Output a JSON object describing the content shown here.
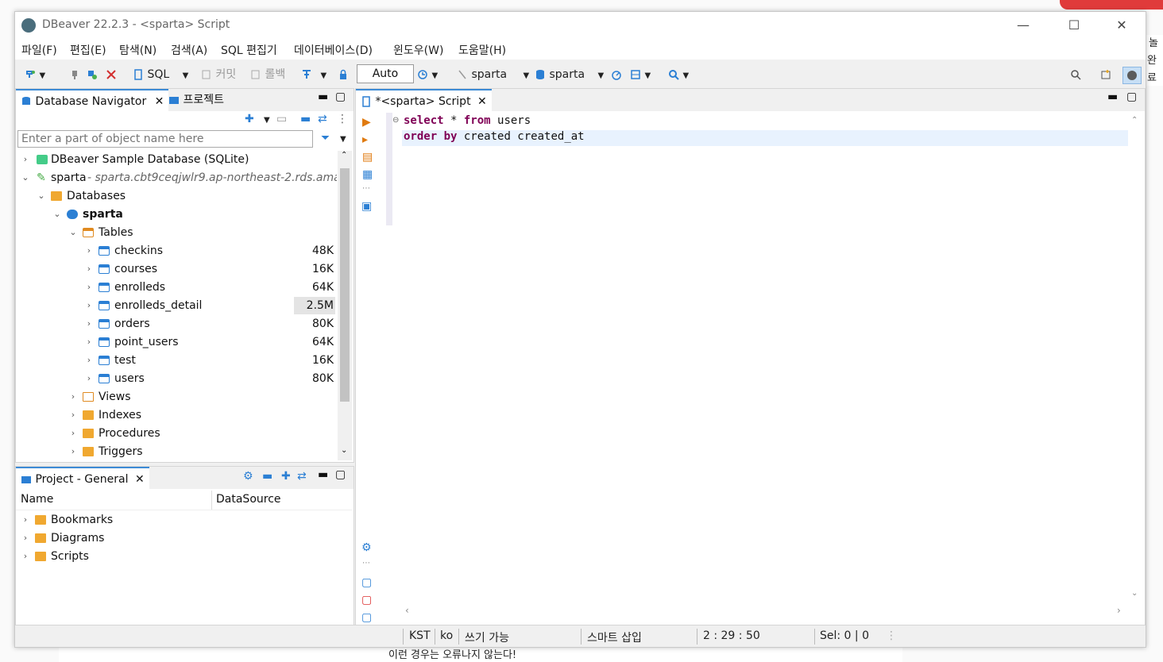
{
  "window": {
    "title": "DBeaver 22.2.3 - <sparta> Script",
    "controls": {
      "minimize": "—",
      "maximize": "☐",
      "close": "✕"
    }
  },
  "menu": [
    "파일(F)",
    "편집(E)",
    "탐색(N)",
    "검색(A)",
    "SQL 편집기",
    "데이터베이스(D)",
    "윈도우(W)",
    "도움말(H)"
  ],
  "toolbar": {
    "sql": "SQL",
    "commit": "커밋",
    "rollback": "롤백",
    "auto": "Auto",
    "datasource": "sparta",
    "schema": "sparta"
  },
  "navigator": {
    "tab_label": "Database Navigator",
    "tab2_label": "프로젝트",
    "filter_placeholder": "Enter a part of object name here",
    "tree": {
      "sample_db": "DBeaver Sample Database (SQLite)",
      "conn_name": "sparta",
      "conn_host": " - sparta.cbt9ceqjwlr9.ap-northeast-2.rds.amaz",
      "databases": "Databases",
      "db_sparta": "sparta",
      "tables_folder": "Tables",
      "tables": [
        {
          "name": "checkins",
          "size": "48K"
        },
        {
          "name": "courses",
          "size": "16K"
        },
        {
          "name": "enrolleds",
          "size": "64K"
        },
        {
          "name": "enrolleds_detail",
          "size": "2.5M"
        },
        {
          "name": "orders",
          "size": "80K"
        },
        {
          "name": "point_users",
          "size": "64K"
        },
        {
          "name": "test",
          "size": "16K"
        },
        {
          "name": "users",
          "size": "80K"
        }
      ],
      "views": "Views",
      "indexes": "Indexes",
      "procedures": "Procedures",
      "triggers": "Triggers"
    }
  },
  "project": {
    "tab_label": "Project - General",
    "col_name": "Name",
    "col_datasource": "DataSource",
    "items": [
      "Bookmarks",
      "Diagrams",
      "Scripts"
    ]
  },
  "editor": {
    "tab_label": "*<sparta> Script",
    "line1": {
      "kw1": "select",
      "t1": " * ",
      "kw2": "from",
      "t2": " users"
    },
    "line2": {
      "kw1": "order",
      "t1": " ",
      "kw2": "by",
      "t2": " created created_at"
    }
  },
  "status": {
    "tz": "KST",
    "lang": "ko",
    "mode": "쓰기 가능",
    "insert": "스마트 삽입",
    "pos": "2 : 29 : 50",
    "sel": "Sel: 0 | 0"
  },
  "background": {
    "side_text1": "놀",
    "side_text2": "완료",
    "bottom_text": "이런 경우는 오류나지 않는다!"
  },
  "colors": {
    "accent": "#3d8bd6",
    "keyword": "#7f0055",
    "folder": "#f0a830",
    "table": "#2b7fd4"
  }
}
